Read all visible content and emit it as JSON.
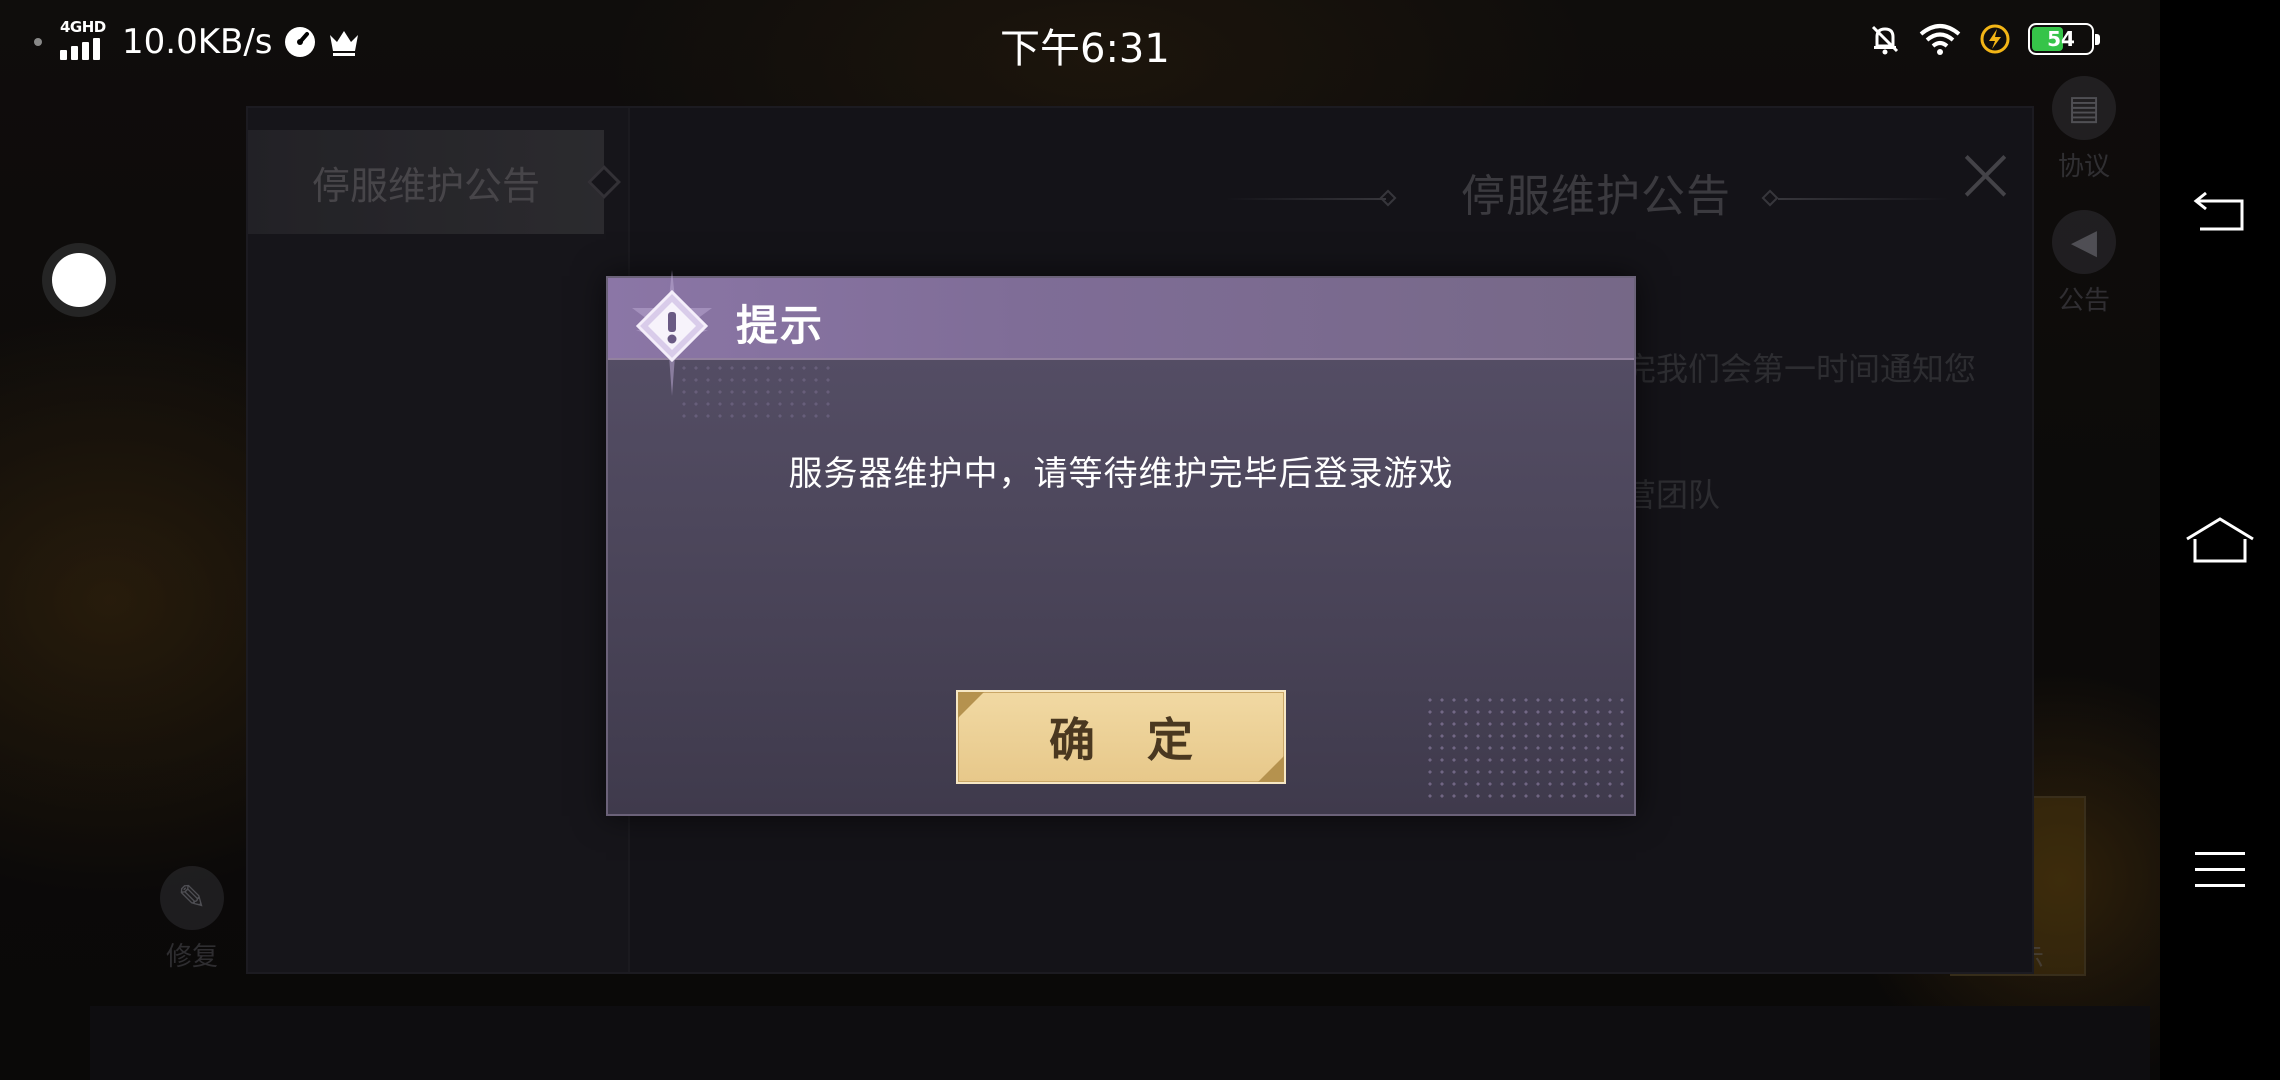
{
  "status_bar": {
    "network_type": "4GHD",
    "net_speed": "10.0KB/s",
    "time": "下午6:31",
    "battery_level": "54",
    "battery_fraction": 0.54,
    "battery_color": "#36c449",
    "icons": [
      "signal-icon",
      "speedometer-icon",
      "crown-icon",
      "bell-muted-icon",
      "wifi-icon",
      "charging-bolt-icon",
      "battery-icon"
    ]
  },
  "background_app": {
    "right_icons": [
      {
        "label": "协议",
        "icon": "document-icon"
      },
      {
        "label": "公告",
        "icon": "megaphone-icon"
      }
    ],
    "left_icon": {
      "label": "修复",
      "icon": "wrench-icon"
    },
    "bottom_right_label": "提示"
  },
  "notice_panel": {
    "tab_label": "停服维护公告",
    "title": "停服维护公告",
    "lines": [
      "完我们会第一时间通知您",
      "营团队"
    ]
  },
  "modal": {
    "title": "提示",
    "message": "服务器维护中，请等待维护完毕后登录游戏",
    "confirm_label": "确 定",
    "colors": {
      "header": "#8b76a6",
      "body": "#4d475c",
      "button": "#e7c88a"
    }
  },
  "nav_bar": {
    "buttons": [
      "back-icon",
      "home-icon",
      "menu-icon"
    ]
  }
}
